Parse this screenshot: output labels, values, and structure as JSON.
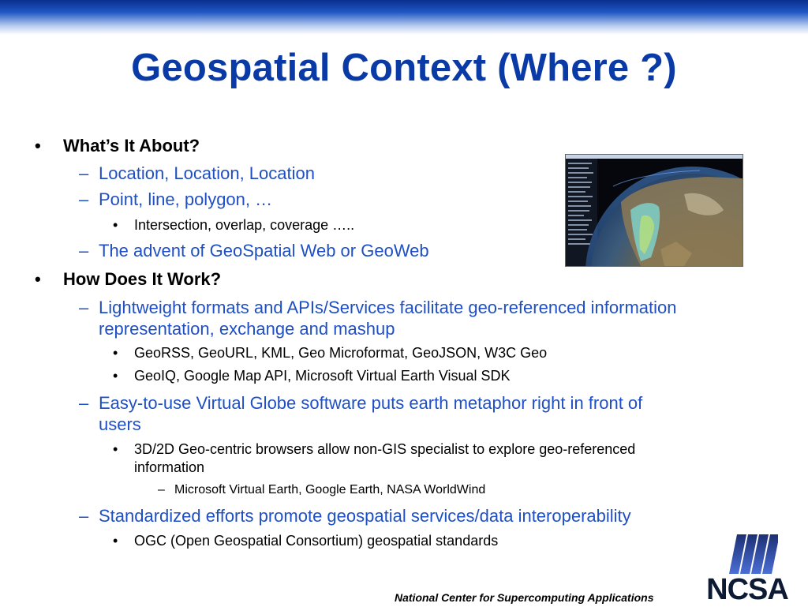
{
  "slide": {
    "title": "Geospatial Context (Where ?)",
    "bullets": {
      "b1": "What’s It About?",
      "b1_1": "Location, Location, Location",
      "b1_2": "Point, line, polygon, …",
      "b1_2_1": "Intersection, overlap, coverage …..",
      "b1_3": "The advent of GeoSpatial Web or GeoWeb",
      "b2": "How Does It Work?",
      "b2_1_line1": "Lightweight formats and APIs/Services facilitate geo-referenced information",
      "b2_1_line2": "representation, exchange and mashup",
      "b2_1_1": "GeoRSS, GeoURL, KML, Geo Microformat, GeoJSON, W3C Geo",
      "b2_1_2": "GeoIQ, Google Map API, Microsoft Virtual Earth Visual SDK",
      "b2_2_line1": "Easy-to-use Virtual Globe software puts earth metaphor right in front of",
      "b2_2_line2": "users",
      "b2_2_1_line1": "3D/2D Geo-centric browsers allow non-GIS specialist to explore geo-referenced",
      "b2_2_1_line2": "information",
      "b2_2_1_1": "Microsoft Virtual Earth, Google Earth, NASA WorldWind",
      "b2_3": "Standardized efforts promote geospatial services/data interoperability",
      "b2_3_1": "OGC (Open Geospatial Consortium) geospatial standards"
    },
    "markers": {
      "bullet": "•",
      "dash": "–"
    },
    "footer": "National Center for Supercomputing Applications",
    "logo_text": "NCSA",
    "colors": {
      "title": "#0a3aa6",
      "sub": "#1f4fc4",
      "band": "#1f57c4"
    }
  }
}
